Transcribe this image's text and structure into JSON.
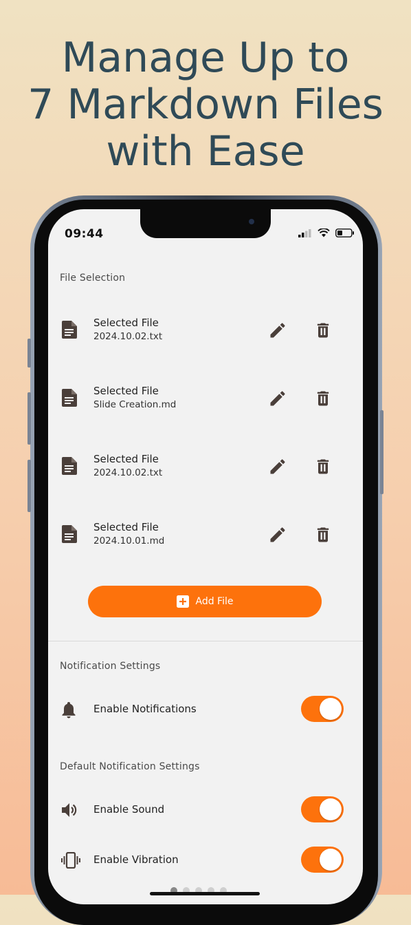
{
  "headline": {
    "line1": "Manage Up to",
    "line2": "7 Markdown Files",
    "line3": "with Ease"
  },
  "status_bar": {
    "time": "09:44",
    "icons": [
      "signal-icon",
      "wifi-icon",
      "battery-icon"
    ]
  },
  "file_selection": {
    "title": "File Selection",
    "items": [
      {
        "title": "Selected File",
        "file": "2024.10.02.txt"
      },
      {
        "title": "Selected File",
        "file": "Slide Creation.md"
      },
      {
        "title": "Selected File",
        "file": "2024.10.02.txt"
      },
      {
        "title": "Selected File",
        "file": "2024.10.01.md"
      }
    ],
    "add_label": "Add File"
  },
  "notification_settings": {
    "title": "Notification Settings",
    "enable_label": "Enable Notifications",
    "enabled": true
  },
  "default_notification_settings": {
    "title": "Default Notification Settings",
    "sound_label": "Enable Sound",
    "sound_enabled": true,
    "vibration_label": "Enable Vibration",
    "vibration_enabled": true
  },
  "colors": {
    "accent": "#fd720c",
    "headline": "#2f4a57",
    "icon": "#4a3f3a"
  },
  "pagination": {
    "pages": 5,
    "current": 1
  }
}
